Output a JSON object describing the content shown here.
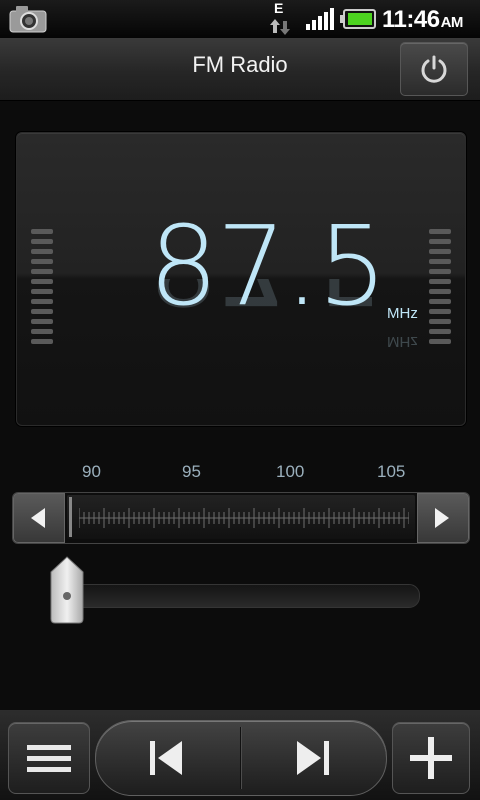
{
  "status_bar": {
    "network_type": "E",
    "time": "11:46",
    "ampm": "AM",
    "icons": [
      "camera-icon",
      "data-activity-icon",
      "signal-strength-icon",
      "battery-charging-icon"
    ]
  },
  "header": {
    "title": "FM Radio",
    "power_icon": "power-icon"
  },
  "display": {
    "frequency": "87.5",
    "unit": "MHz"
  },
  "scale": {
    "labels": [
      "90",
      "95",
      "100",
      "105"
    ]
  },
  "tuner": {
    "prev_icon": "arrow-left-icon",
    "next_icon": "arrow-right-icon"
  },
  "volume": {
    "level": 0.0
  },
  "toolbar": {
    "menu_icon": "menu-icon",
    "prev_icon": "skip-previous-icon",
    "next_icon": "skip-next-icon",
    "add_icon": "add-icon"
  },
  "colors": {
    "frequency_text": "#bfe6f7",
    "scale_text": "#9bb0bd",
    "battery_fill": "#4cd21f"
  }
}
